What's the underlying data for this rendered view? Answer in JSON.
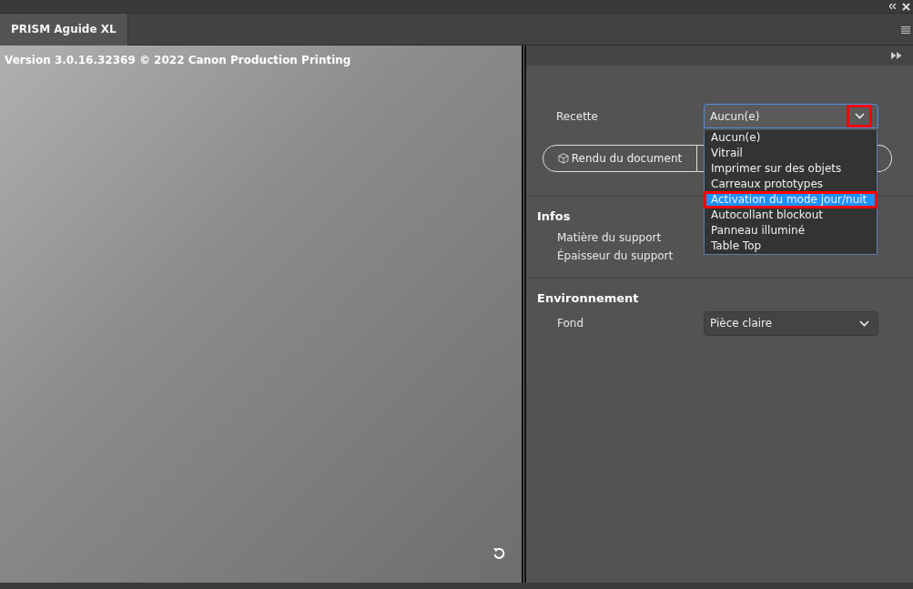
{
  "tabs": [
    {
      "label": "PRISM Aguide XL",
      "selected": true
    }
  ],
  "preview": {
    "version_text": "Version 3.0.16.32369 © 2022 Canon Production Printing"
  },
  "recipe": {
    "label": "Recette",
    "value": "Aucun(e)",
    "expanded": true,
    "toggle_annotated": true,
    "options": [
      {
        "label": "Aucun(e)",
        "highlighted": false,
        "annotated": false
      },
      {
        "label": "Vitrail",
        "highlighted": false,
        "annotated": false
      },
      {
        "label": "Imprimer sur des objets",
        "highlighted": false,
        "annotated": false
      },
      {
        "label": "Carreaux prototypes",
        "highlighted": false,
        "annotated": false
      },
      {
        "label": "Activation du mode jour/nuit",
        "highlighted": true,
        "annotated": true
      },
      {
        "label": "Autocollant blockout",
        "highlighted": false,
        "annotated": false
      },
      {
        "label": "Panneau illuminé",
        "highlighted": false,
        "annotated": false
      },
      {
        "label": "Table Top",
        "highlighted": false,
        "annotated": false
      }
    ]
  },
  "render_button": {
    "label": "Rendu du document"
  },
  "sections": [
    {
      "title": "Infos",
      "rows": [
        {
          "kind": "text",
          "label": "Matière du support"
        },
        {
          "kind": "text",
          "label": "Épaisseur du support"
        }
      ]
    },
    {
      "title": "Environnement",
      "rows": [
        {
          "kind": "select",
          "label": "Fond",
          "value": "Pièce claire"
        }
      ]
    }
  ]
}
